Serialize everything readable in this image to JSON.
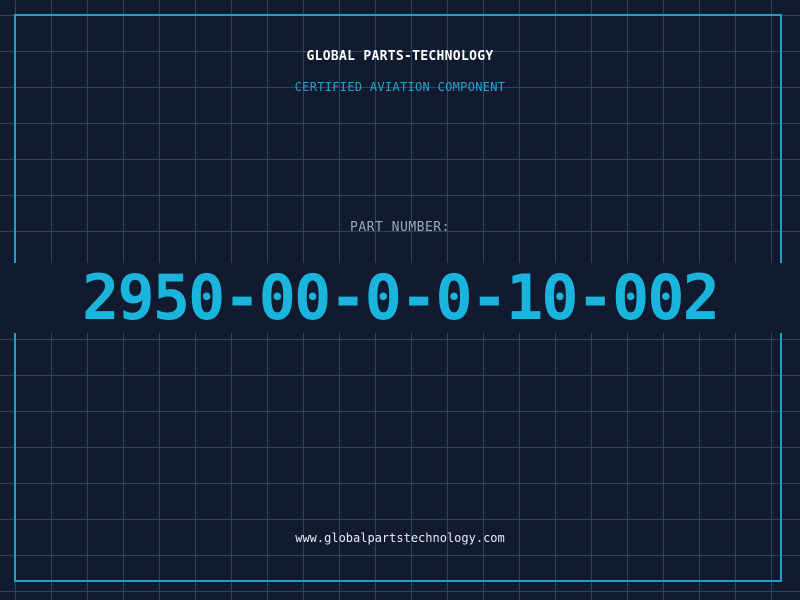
{
  "header": {
    "brand": "GLOBAL PARTS-TECHNOLOGY",
    "tagline": "CERTIFIED AVIATION COMPONENT"
  },
  "part": {
    "label": "PART NUMBER:",
    "number": "2950-00-0-0-10-002"
  },
  "footer": {
    "website": "www.globalpartstechnology.com"
  },
  "colors": {
    "background": "#111a2e",
    "grid": "#1f4a63",
    "accent": "#1ab4dd",
    "frame": "#1aa3c7"
  }
}
